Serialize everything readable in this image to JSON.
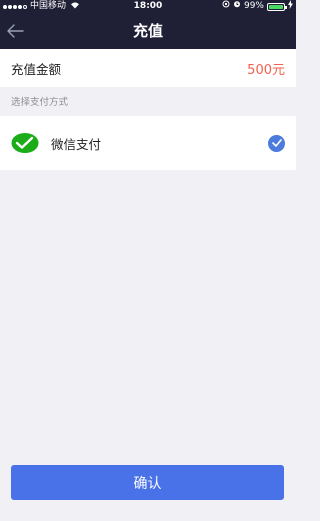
{
  "status_bar": {
    "carrier": "中国移动",
    "time": "18:00",
    "battery": "99%",
    "battery_level": 0.99
  },
  "nav": {
    "title": "充值",
    "back_icon": "arrow-left-icon"
  },
  "amount": {
    "label": "充值金额",
    "value": "500元"
  },
  "payment": {
    "section_label": "选择支付方式",
    "method_label": "微信支付",
    "method_icon": "wechat-icon",
    "selected": true
  },
  "confirm_label": "确认",
  "colors": {
    "nav_bg": "#1f2036",
    "accent": "#4a72e8",
    "amount": "#f0614e",
    "wechat": "#1aad19"
  }
}
